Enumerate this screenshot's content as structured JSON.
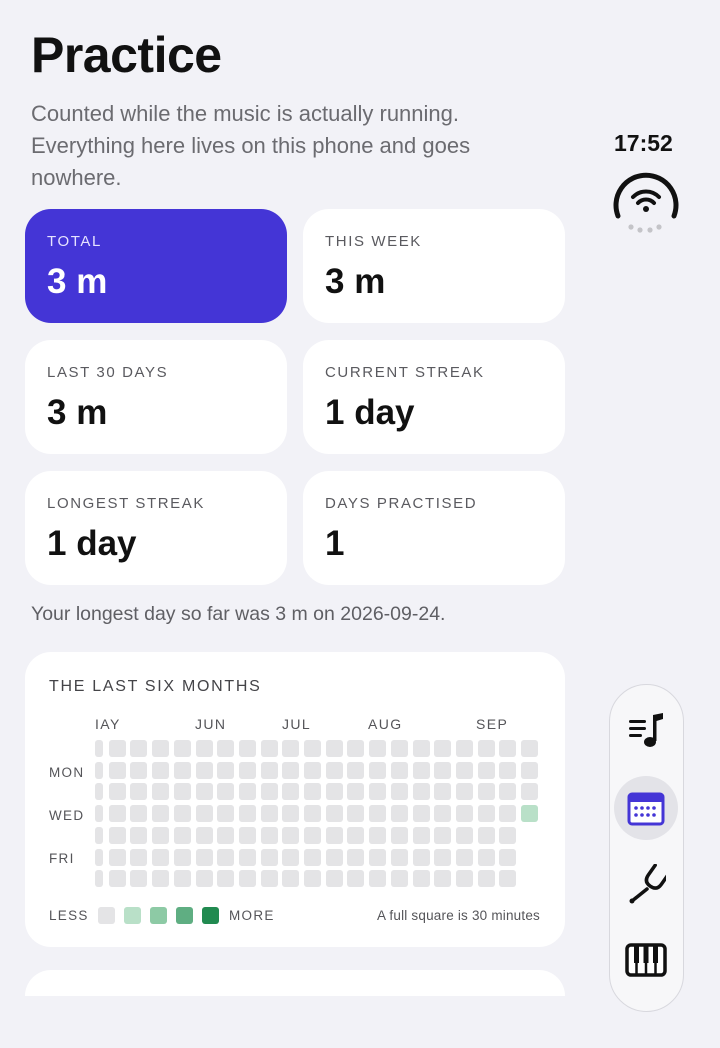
{
  "page": {
    "title": "Practice",
    "subtitle": "Counted while the music is actually running. Everything here lives on this phone and goes nowhere."
  },
  "status": {
    "time": "17:52"
  },
  "stats": [
    {
      "label": "TOTAL",
      "value": "3 m"
    },
    {
      "label": "THIS WEEK",
      "value": "3 m"
    },
    {
      "label": "LAST 30 DAYS",
      "value": "3 m"
    },
    {
      "label": "CURRENT STREAK",
      "value": "1 day"
    },
    {
      "label": "LONGEST STREAK",
      "value": "1 day"
    },
    {
      "label": "DAYS PRACTISED",
      "value": "1"
    }
  ],
  "longest_day": "Your longest day so far was 3 m on 2026-09-24.",
  "heatmap": {
    "title": "THE LAST SIX MONTHS",
    "months": [
      "IAY",
      "JUN",
      "JUL",
      "AUG",
      "SEP"
    ],
    "day_labels": [
      "MON",
      "WED",
      "FRI"
    ],
    "legend_less": "LESS",
    "legend_more": "MORE",
    "note": "A full square is 30 minutes",
    "colors": [
      "#e4e4e6",
      "#b9e0c8",
      "#8dcaa5",
      "#5fae82",
      "#218a50"
    ],
    "active_day_level": 1
  },
  "nav": {
    "items": [
      {
        "name": "queue-music-icon",
        "selected": false
      },
      {
        "name": "calendar-icon",
        "selected": true
      },
      {
        "name": "tuning-fork-icon",
        "selected": false
      },
      {
        "name": "piano-keys-icon",
        "selected": false
      }
    ]
  },
  "accent": "#4435d6"
}
